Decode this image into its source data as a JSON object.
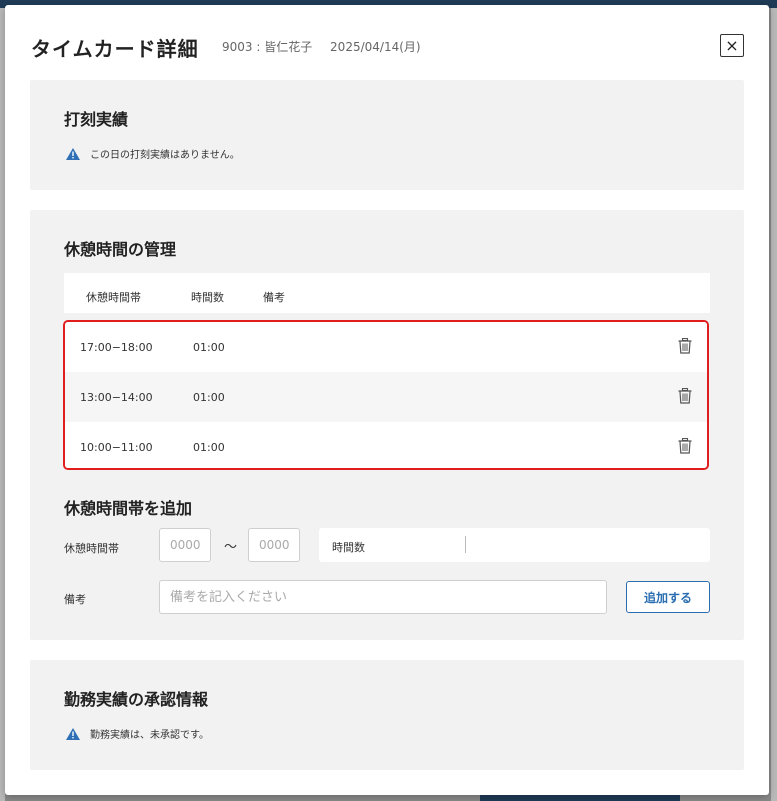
{
  "modal": {
    "title": "タイムカード詳細",
    "employee": "9003 : 皆仁花子",
    "date": "2025/04/14(月)",
    "close_label": "×"
  },
  "punch_section": {
    "title": "打刻実績",
    "notice": "この日の打刻実績はありません。"
  },
  "break_section": {
    "title": "休憩時間の管理",
    "columns": [
      "休憩時間帯",
      "時間数",
      "備考"
    ],
    "rows": [
      {
        "time": "17:00−18:00",
        "hours": "01:00",
        "note": ""
      },
      {
        "time": "13:00−14:00",
        "hours": "01:00",
        "note": ""
      },
      {
        "time": "10:00−11:00",
        "hours": "01:00",
        "note": ""
      }
    ]
  },
  "add_break": {
    "title": "休憩時間帯を追加",
    "period_label": "休憩時間帯",
    "start_placeholder": "0000",
    "end_placeholder": "0000",
    "tilde": "〜",
    "hours_label": "時間数",
    "note_label": "備考",
    "note_placeholder": "備考を記入ください",
    "add_button": "追加する"
  },
  "approval_section": {
    "title": "勤務実績の承認情報",
    "notice": "勤務実績は、未承認です。"
  },
  "colors": {
    "accent": "#2a6db0",
    "highlight": "#e01e1e",
    "warning_icon": "#2f6fb5",
    "section_bg": "#f2f2f2"
  },
  "icons": {
    "warning": "warning-triangle-icon",
    "delete": "trash-icon",
    "close": "close-icon"
  }
}
